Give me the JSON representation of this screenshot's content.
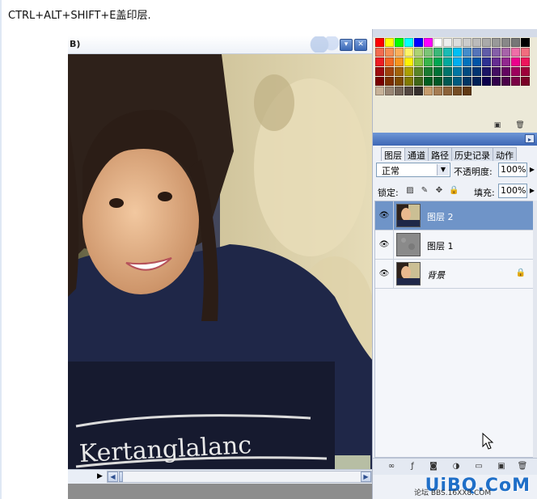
{
  "caption": "CTRL+ALT+SHIFT+E盖印层.",
  "document": {
    "title": "B)",
    "minimize_glyph": "▾",
    "close_glyph": "✕"
  },
  "swatches": {
    "colors": [
      "#ff0000",
      "#ffff00",
      "#00ff00",
      "#00ffff",
      "#0000ff",
      "#ff00ff",
      "#ffffff",
      "#eeeeee",
      "#dddddd",
      "#cccccc",
      "#bbbbbb",
      "#aaaaaa",
      "#999999",
      "#888888",
      "#777777",
      "#000000",
      "#f26c4f",
      "#f68e55",
      "#fbaf5c",
      "#fff467",
      "#acd372",
      "#7cc576",
      "#3bb878",
      "#1abbb4",
      "#00bff3",
      "#438ccb",
      "#5574b9",
      "#605ca8",
      "#855fa8",
      "#a763a9",
      "#ef6ea8",
      "#f16d7e",
      "#ed1c24",
      "#f26522",
      "#f7941d",
      "#fff200",
      "#8dc63f",
      "#39b54a",
      "#00a651",
      "#00a99d",
      "#00aeef",
      "#0072bc",
      "#0054a6",
      "#2e3192",
      "#662d91",
      "#92278f",
      "#ec008c",
      "#ed145b",
      "#9e0b0f",
      "#a0410d",
      "#a36209",
      "#aba000",
      "#598527",
      "#1a7b30",
      "#007236",
      "#00746b",
      "#0076a3",
      "#004b80",
      "#003471",
      "#1b1464",
      "#440e62",
      "#630460",
      "#9e005d",
      "#9e0039",
      "#790000",
      "#7b2e00",
      "#7d4900",
      "#827b00",
      "#406618",
      "#005e20",
      "#005826",
      "#005952",
      "#005b7f",
      "#003663",
      "#002157",
      "#0d004c",
      "#32004b",
      "#4b0049",
      "#7b0046",
      "#7a0026",
      "#c7b299",
      "#998675",
      "#736357",
      "#534741",
      "#362f2d",
      "#c69c6d",
      "#a67c52",
      "#8c6239",
      "#754c24",
      "#603913"
    ],
    "new_glyph": "▣",
    "delete_glyph": "🗑"
  },
  "layers_panel": {
    "tabs": [
      "图层",
      "通道",
      "路径",
      "历史记录",
      "动作"
    ],
    "blend_mode": "正常",
    "opacity_label": "不透明度:",
    "opacity_value": "100%",
    "lock_label": "锁定:",
    "fill_label": "填充:",
    "fill_value": "100%",
    "layers": [
      {
        "name": "图层 2",
        "selected": true
      },
      {
        "name": "图层 1",
        "selected": false
      },
      {
        "name": "背景",
        "selected": false,
        "locked": true
      }
    ]
  },
  "watermark": {
    "text": "UiBQ.CoM",
    "sub": "论坛 BBS.16XX8.COM"
  }
}
